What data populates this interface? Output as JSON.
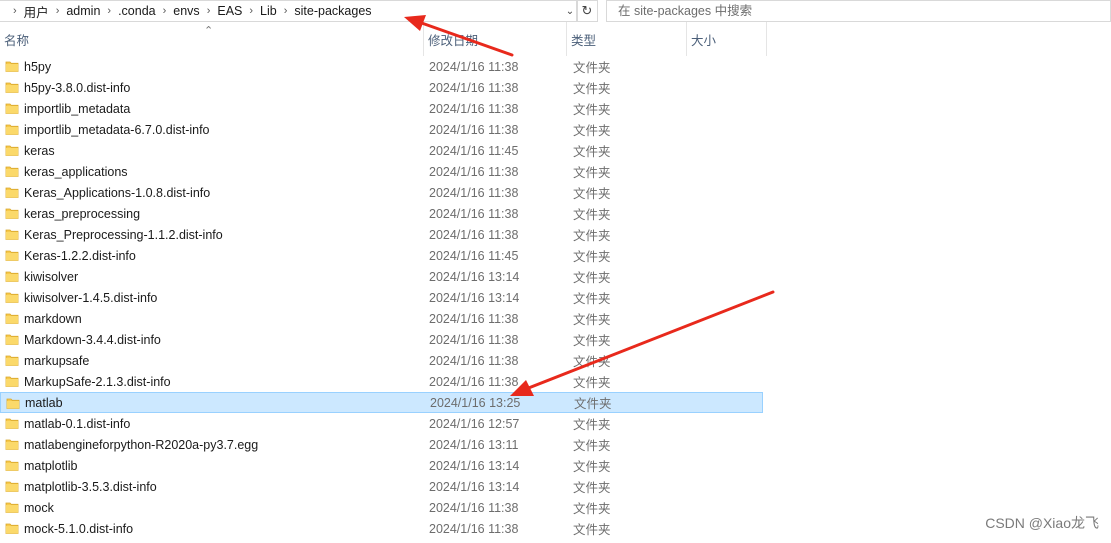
{
  "address": {
    "crumbs": [
      "用户",
      "admin",
      ".conda",
      "envs",
      "EAS",
      "Lib",
      "site-packages"
    ],
    "dropdown_icon": "chevron-down-icon",
    "refresh_icon": "refresh-icon"
  },
  "search": {
    "placeholder": "在 site-packages 中搜索"
  },
  "columns": {
    "name": "名称",
    "date": "修改日期",
    "type": "类型",
    "size": "大小",
    "sort": "ascending"
  },
  "files": [
    {
      "name": "h5py",
      "date": "2024/1/16 11:38",
      "type": "文件夹",
      "selected": false
    },
    {
      "name": "h5py-3.8.0.dist-info",
      "date": "2024/1/16 11:38",
      "type": "文件夹",
      "selected": false
    },
    {
      "name": "importlib_metadata",
      "date": "2024/1/16 11:38",
      "type": "文件夹",
      "selected": false
    },
    {
      "name": "importlib_metadata-6.7.0.dist-info",
      "date": "2024/1/16 11:38",
      "type": "文件夹",
      "selected": false
    },
    {
      "name": "keras",
      "date": "2024/1/16 11:45",
      "type": "文件夹",
      "selected": false
    },
    {
      "name": "keras_applications",
      "date": "2024/1/16 11:38",
      "type": "文件夹",
      "selected": false
    },
    {
      "name": "Keras_Applications-1.0.8.dist-info",
      "date": "2024/1/16 11:38",
      "type": "文件夹",
      "selected": false
    },
    {
      "name": "keras_preprocessing",
      "date": "2024/1/16 11:38",
      "type": "文件夹",
      "selected": false
    },
    {
      "name": "Keras_Preprocessing-1.1.2.dist-info",
      "date": "2024/1/16 11:38",
      "type": "文件夹",
      "selected": false
    },
    {
      "name": "Keras-1.2.2.dist-info",
      "date": "2024/1/16 11:45",
      "type": "文件夹",
      "selected": false
    },
    {
      "name": "kiwisolver",
      "date": "2024/1/16 13:14",
      "type": "文件夹",
      "selected": false
    },
    {
      "name": "kiwisolver-1.4.5.dist-info",
      "date": "2024/1/16 13:14",
      "type": "文件夹",
      "selected": false
    },
    {
      "name": "markdown",
      "date": "2024/1/16 11:38",
      "type": "文件夹",
      "selected": false
    },
    {
      "name": "Markdown-3.4.4.dist-info",
      "date": "2024/1/16 11:38",
      "type": "文件夹",
      "selected": false
    },
    {
      "name": "markupsafe",
      "date": "2024/1/16 11:38",
      "type": "文件夹",
      "selected": false
    },
    {
      "name": "MarkupSafe-2.1.3.dist-info",
      "date": "2024/1/16 11:38",
      "type": "文件夹",
      "selected": false
    },
    {
      "name": "matlab",
      "date": "2024/1/16 13:25",
      "type": "文件夹",
      "selected": true
    },
    {
      "name": "matlab-0.1.dist-info",
      "date": "2024/1/16 12:57",
      "type": "文件夹",
      "selected": false
    },
    {
      "name": "matlabengineforpython-R2020a-py3.7.egg",
      "date": "2024/1/16 13:11",
      "type": "文件夹",
      "selected": false
    },
    {
      "name": "matplotlib",
      "date": "2024/1/16 13:14",
      "type": "文件夹",
      "selected": false
    },
    {
      "name": "matplotlib-3.5.3.dist-info",
      "date": "2024/1/16 13:14",
      "type": "文件夹",
      "selected": false
    },
    {
      "name": "mock",
      "date": "2024/1/16 11:38",
      "type": "文件夹",
      "selected": false
    },
    {
      "name": "mock-5.1.0.dist-info",
      "date": "2024/1/16 11:38",
      "type": "文件夹",
      "selected": false
    }
  ],
  "folder_icon": "folder-icon",
  "folder_color": "#f7c94b",
  "selection_color": "#cce8ff",
  "annotation_color": "#e8291c",
  "watermark": "CSDN @Xiao龙飞"
}
